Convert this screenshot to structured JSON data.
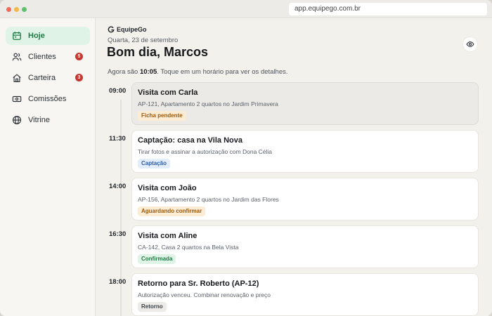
{
  "browser": {
    "url": "app.equipego.com.br"
  },
  "sidebar": {
    "items": [
      {
        "label": "Hoje",
        "icon": "calendar-icon",
        "active": true,
        "badge": ""
      },
      {
        "label": "Clientes",
        "icon": "users-icon",
        "active": false,
        "badge": "5"
      },
      {
        "label": "Carteira",
        "icon": "home-icon",
        "active": false,
        "badge": "3"
      },
      {
        "label": "Comissões",
        "icon": "banknote-icon",
        "active": false,
        "badge": ""
      },
      {
        "label": "Vitrine",
        "icon": "globe-icon",
        "active": false,
        "badge": ""
      }
    ]
  },
  "header": {
    "brand": "EquipeGo",
    "date": "Quarta, 23 de setembro",
    "greeting": "Bom dia, Marcos",
    "now_prefix": "Agora são ",
    "now_time": "10:05",
    "now_suffix": ". Toque em um horário para ver os detalhes."
  },
  "schedule": [
    {
      "time": "09:00",
      "title": "Visita com Carla",
      "description": "AP-121, Apartamento 2 quartos no Jardim Primavera",
      "tag": "Ficha pendente"
    },
    {
      "time": "11:30",
      "title": "Captação: casa na Vila Nova",
      "description": "Tirar fotos e assinar a autorização com Dona Célia",
      "tag": "Captação"
    },
    {
      "time": "14:00",
      "title": "Visita com João",
      "description": "AP-156, Apartamento 2 quartos no Jardim das Flores",
      "tag": "Aguardando confirmar"
    },
    {
      "time": "16:30",
      "title": "Visita com Aline",
      "description": "CA-142, Casa 2 quartos na Bela Vista",
      "tag": "Confirmada"
    },
    {
      "time": "18:00",
      "title": "Retorno para Sr. Roberto (AP-12)",
      "description": "Autorização venceu. Combinar renovação e preço",
      "tag": "Retorno"
    }
  ],
  "colors": {
    "accent_green": "#1f7a45",
    "badge_red": "#c7362f",
    "pending_orange": "#9b5a10",
    "capture_blue": "#2a5ca8"
  }
}
